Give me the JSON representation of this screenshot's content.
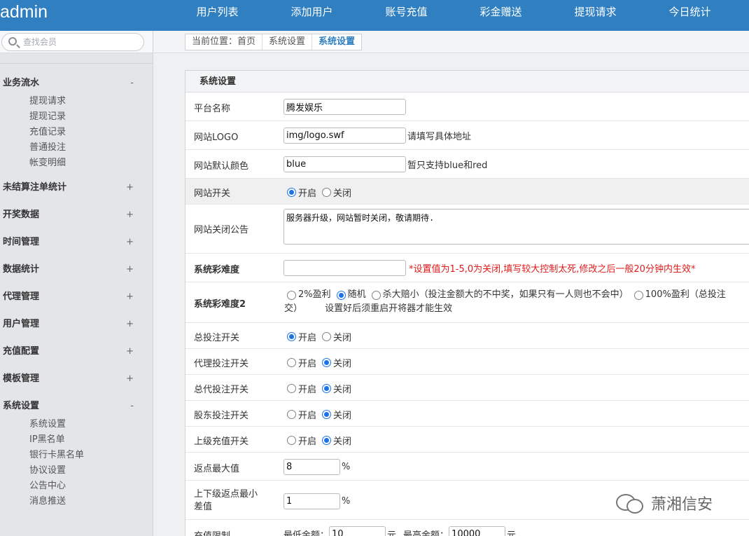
{
  "header": {
    "brand": "admin",
    "nav": [
      "用户列表",
      "添加用户",
      "账号充值",
      "彩金赠送",
      "提现请求",
      "今日统计"
    ]
  },
  "sidebar": {
    "search_placeholder": "查找会员",
    "groups": [
      {
        "label": "业务流水",
        "toggle": "-",
        "items": [
          "提现请求",
          "提现记录",
          "充值记录",
          "普通投注",
          "帐变明细"
        ]
      },
      {
        "label": "未结算注单统计",
        "toggle": "+"
      },
      {
        "label": "开奖数据",
        "toggle": "+"
      },
      {
        "label": "时间管理",
        "toggle": "+"
      },
      {
        "label": "数据统计",
        "toggle": "+"
      },
      {
        "label": "代理管理",
        "toggle": "+"
      },
      {
        "label": "用户管理",
        "toggle": "+"
      },
      {
        "label": "充值配置",
        "toggle": "+"
      },
      {
        "label": "模板管理",
        "toggle": "+"
      },
      {
        "label": "系统设置",
        "toggle": "-",
        "items": [
          "系统设置",
          "IP黑名单",
          "银行卡黑名单",
          "协议设置",
          "公告中心",
          "消息推送"
        ]
      }
    ]
  },
  "breadcrumb": [
    "当前位置：首页",
    "系统设置",
    "系统设置"
  ],
  "panel": {
    "title": "系统设置",
    "platform_name": {
      "label": "平台名称",
      "value": "腾发娱乐"
    },
    "logo": {
      "label": "网站LOGO",
      "value": "img/logo.swf",
      "hint": "请填写具体地址"
    },
    "color": {
      "label": "网站默认颜色",
      "value": "blue",
      "hint": "暂只支持blue和red"
    },
    "site_switch": {
      "label": "网站开关",
      "on": "开启",
      "off": "关闭"
    },
    "notice": {
      "label": "网站关闭公告",
      "value": "服务器升级，网站暂时关闭，敬请期待."
    },
    "difficulty": {
      "label": "系统彩难度",
      "value": "",
      "hint": "*设置值为1-5,0为关闭,填写较大控制太死,修改之后一般20分钟内生效*"
    },
    "difficulty2": {
      "label": "系统彩难度2",
      "options": [
        "2%盈利",
        "随机",
        "杀大赔小（投注金额大的不中奖，如果只有一人则也不会中）",
        "100%盈利（总投注"
      ],
      "line2a": "交）",
      "line2b": "设置好后须重启开将器才能生效"
    },
    "bet_switch": {
      "label": "总投注开关",
      "on": "开启",
      "off": "关闭"
    },
    "agent_switch": {
      "label": "代理投注开关",
      "on": "开启",
      "off": "关闭"
    },
    "general_agent_switch": {
      "label": "总代投注开关",
      "on": "开启",
      "off": "关闭"
    },
    "shareholder_switch": {
      "label": "股东投注开关",
      "on": "开启",
      "off": "关闭"
    },
    "parent_recharge_switch": {
      "label": "上级充值开关",
      "on": "开启",
      "off": "关闭"
    },
    "rebate_max": {
      "label": "返点最大值",
      "value": "8",
      "unit": "%"
    },
    "rebate_min_diff": {
      "label1": "上下级返点最小",
      "label2": "差值",
      "value": "1",
      "unit": "%"
    },
    "recharge_limit": {
      "label": "充值限制",
      "min_label": "最低金额：",
      "min": "10",
      "unit1": "元",
      "max_label": "最高金额：",
      "max": "10000",
      "unit2": "元"
    }
  },
  "watermark": "萧湘信安"
}
